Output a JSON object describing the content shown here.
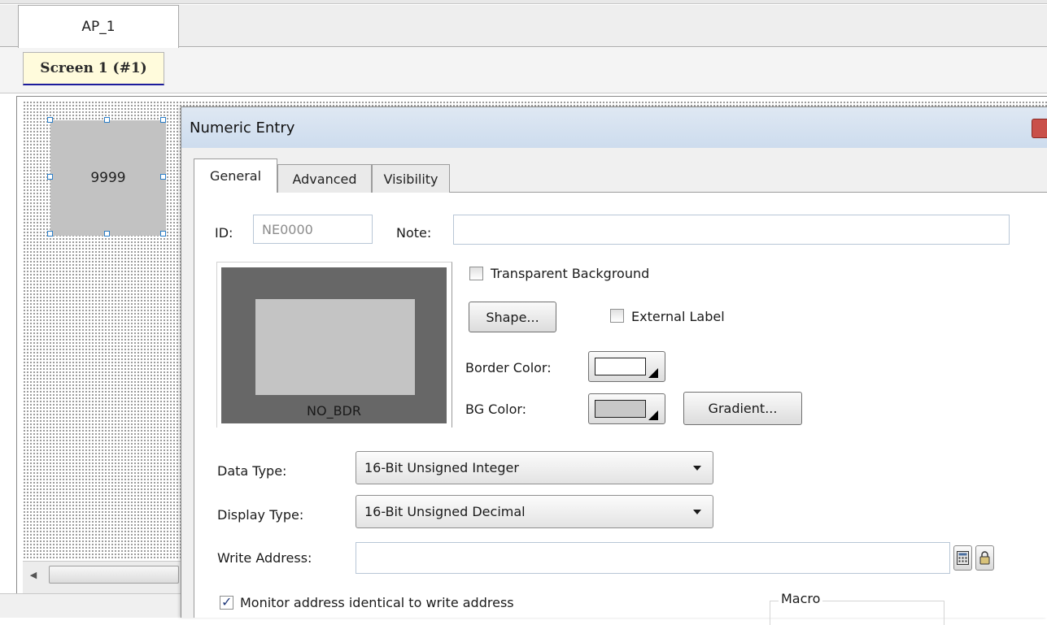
{
  "document_tab": {
    "label": "AP_1"
  },
  "screen_tab": {
    "label": "Screen 1 (#1)"
  },
  "canvas": {
    "widget_value": "9999"
  },
  "dialog": {
    "title": "Numeric Entry",
    "tabs": [
      {
        "label": "General",
        "active": true
      },
      {
        "label": "Advanced",
        "active": false
      },
      {
        "label": "Visibility",
        "active": false
      }
    ],
    "id_label": "ID:",
    "id_value": "NE0000",
    "note_label": "Note:",
    "note_value": "",
    "preview_caption": "NO_BDR",
    "transparent_bg": {
      "label": "Transparent Background",
      "checked": false
    },
    "shape_button": "Shape...",
    "external_label": {
      "label": "External Label",
      "checked": false
    },
    "border_color": {
      "label": "Border Color:",
      "value": "#ffffff"
    },
    "bg_color": {
      "label": "BG Color:",
      "value": "#c8c8c8"
    },
    "gradient_button": "Gradient...",
    "data_type": {
      "label": "Data Type:",
      "value": "16-Bit Unsigned Integer"
    },
    "display_type": {
      "label": "Display Type:",
      "value": "16-Bit Unsigned Decimal"
    },
    "write_address": {
      "label": "Write Address:",
      "value": ""
    },
    "monitor_identical": {
      "label": "Monitor address identical to write address",
      "checked": true
    },
    "macro_group": {
      "label": "Macro"
    }
  }
}
